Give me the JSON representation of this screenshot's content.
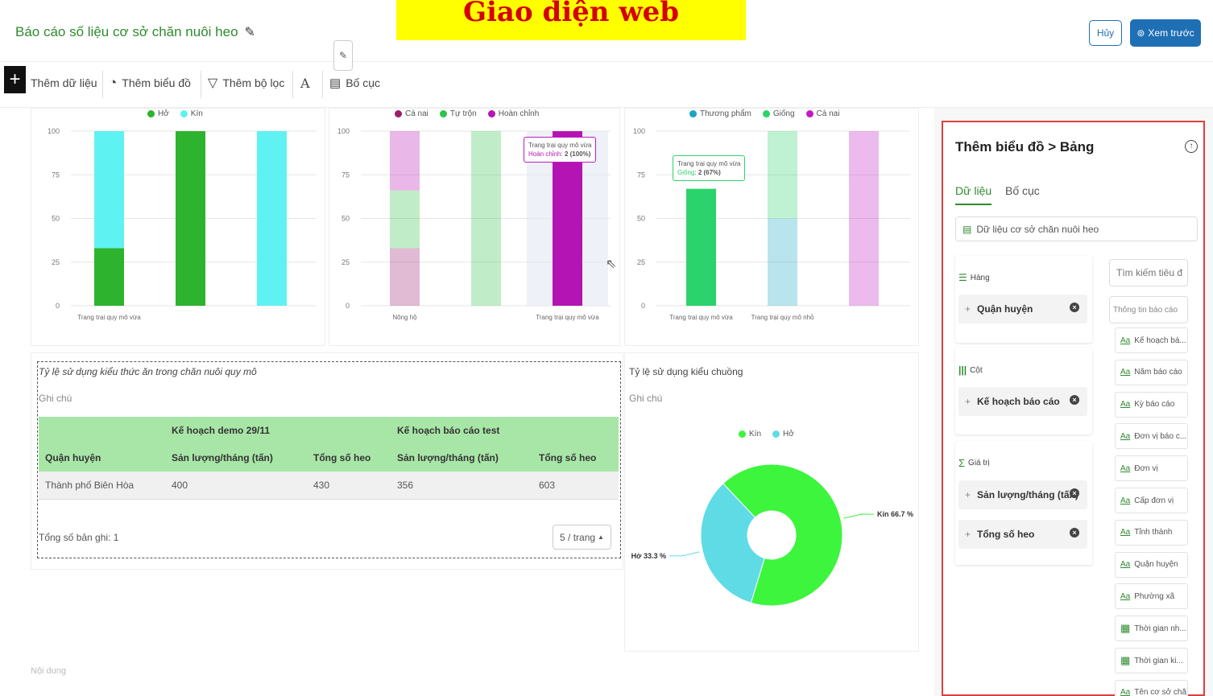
{
  "header": {
    "title": "Báo cáo số liệu cơ sở chăn nuôi heo",
    "banner": "Giao diện web",
    "cancel_label": "Hủy",
    "preview_label": "Xem trước"
  },
  "toolbar": {
    "add_data": "Thêm dữ liệu",
    "add_chart": "Thêm biểu đồ",
    "add_filter": "Thêm bộ lọc",
    "text_tool": "A",
    "layout": "Bố cục"
  },
  "colors": {
    "brand_green": "#2e8b2e",
    "primary_blue": "#1f6fb5",
    "panel_border": "#d9413d"
  },
  "chart_data": [
    {
      "type": "bar",
      "stacked": true,
      "categories": [
        "Trang trại quy mô vừa",
        "",
        ""
      ],
      "series": [
        {
          "name": "Hở",
          "color": "#2db32d",
          "values": [
            33,
            100,
            0
          ]
        },
        {
          "name": "Kín",
          "color": "#5ff2f2",
          "values": [
            67,
            0,
            100
          ]
        }
      ],
      "ylim": [
        0,
        100
      ],
      "yticks": [
        0,
        25,
        50,
        75,
        100
      ]
    },
    {
      "type": "bar",
      "stacked": true,
      "categories": [
        "Nông hộ",
        "",
        "Trang trại quy mô vừa"
      ],
      "series": [
        {
          "name": "Cá nai",
          "color": "#9c1b6e",
          "values": [
            33,
            0,
            0
          ]
        },
        {
          "name": "Tự trộn",
          "color": "#2ec24a",
          "values": [
            33,
            100,
            0
          ]
        },
        {
          "name": "Hoàn chỉnh",
          "color": "#b514b5",
          "values": [
            34,
            0,
            100
          ]
        }
      ],
      "ylim": [
        0,
        100
      ],
      "yticks": [
        0,
        25,
        50,
        75,
        100
      ],
      "tooltip": {
        "title": "Trang trại quy mô vừa",
        "series": "Hoàn chỉnh",
        "value": "2 (100%)"
      }
    },
    {
      "type": "bar",
      "stacked": true,
      "categories": [
        "Trang trại quy mô vừa",
        "Trang trại quy mô nhỏ",
        ""
      ],
      "series": [
        {
          "name": "Thương phẩm",
          "color": "#1aa5c2",
          "values": [
            0,
            50,
            0
          ]
        },
        {
          "name": "Giống",
          "color": "#2ad36b",
          "values": [
            67,
            50,
            0
          ]
        },
        {
          "name": "Cá nai",
          "color": "#c21ac2",
          "values": [
            0,
            0,
            100
          ]
        }
      ],
      "ylim": [
        0,
        100
      ],
      "yticks": [
        0,
        25,
        50,
        75,
        100
      ],
      "tooltip": {
        "title": "Trang trại quy mô vừa",
        "series": "Giống",
        "value": "2 (67%)"
      }
    },
    {
      "type": "pie",
      "donut": true,
      "title": "Tỷ lệ sử dụng kiểu chuồng",
      "slices": [
        {
          "name": "Kín",
          "value": 66.7,
          "color": "#3cf53c",
          "label": "Kín 66.7 %"
        },
        {
          "name": "Hở",
          "value": 33.3,
          "color": "#5fdbe6",
          "label": "Hở 33.3 %"
        }
      ]
    }
  ],
  "table_section": {
    "title": "Tỷ lệ sử dụng kiểu thức ăn trong chăn nuôi quy mô",
    "note": "Ghi chú",
    "group_headers": [
      "Kế hoạch demo 29/11",
      "Kế hoạch báo cáo test"
    ],
    "columns": [
      "Quận huyện",
      "Sản lượng/tháng (tấn)",
      "Tổng số heo",
      "Sản lượng/tháng (tấn)",
      "Tổng số heo"
    ],
    "rows": [
      [
        "Thành phố Biên Hòa",
        "400",
        "430",
        "356",
        "603"
      ]
    ],
    "total": "Tổng số bản ghi: 1",
    "page_size": "5 / trang"
  },
  "pie_section": {
    "title": "Tỷ lệ sử dụng kiểu chuồng",
    "note": "Ghi chú"
  },
  "content_placeholder": "Nội dung",
  "panel": {
    "title": "Thêm biểu đồ > Bảng",
    "tabs": [
      "Dữ liệu",
      "Bố cục"
    ],
    "dataset": "Dữ liệu cơ sở chăn nuôi heo",
    "rows_label": "Hàng",
    "rows_fields": [
      "Quận huyện"
    ],
    "cols_label": "Cột",
    "cols_fields": [
      "Kế hoạch báo cáo"
    ],
    "values_label": "Giá trị",
    "values_fields": [
      "Sản lượng/tháng (tấn)",
      "Tổng số heo"
    ],
    "search_placeholder": "Tìm kiếm tiêu đ",
    "info_placeholder": "Thông tin báo cáo",
    "field_list": [
      {
        "type": "text",
        "label": "Kế hoạch bá..."
      },
      {
        "type": "text",
        "label": "Năm báo cáo"
      },
      {
        "type": "text",
        "label": "Kỳ báo cáo"
      },
      {
        "type": "text",
        "label": "Đơn vị báo c..."
      },
      {
        "type": "text",
        "label": "Đơn vị"
      },
      {
        "type": "text",
        "label": "Cấp đơn vị"
      },
      {
        "type": "text",
        "label": "Tỉnh thành"
      },
      {
        "type": "text",
        "label": "Quận huyện"
      },
      {
        "type": "text",
        "label": "Phường xã"
      },
      {
        "type": "date",
        "label": "Thời gian nh..."
      },
      {
        "type": "date",
        "label": "Thời gian ki..."
      },
      {
        "type": "text",
        "label": "Tên cơ sở chă..."
      }
    ]
  }
}
